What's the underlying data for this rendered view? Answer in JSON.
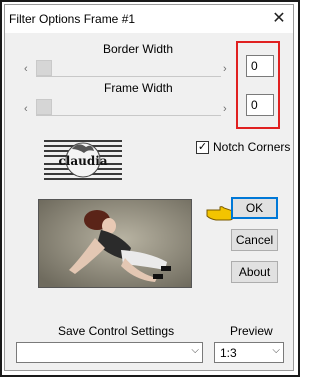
{
  "window": {
    "title": "Filter Options Frame #1",
    "close_glyph": "✕"
  },
  "border_width": {
    "label": "Border Width",
    "value": "0",
    "slider_level": 0
  },
  "frame_width": {
    "label": "Frame Width",
    "value": "0",
    "slider_level": 0
  },
  "slider_arrows": {
    "left": "‹",
    "right": "›"
  },
  "logo": {
    "text": "claudia"
  },
  "notch_corners": {
    "label": "Notch Corners",
    "checked": true,
    "check_glyph": "✓"
  },
  "buttons": {
    "ok": "OK",
    "cancel": "Cancel",
    "about": "About"
  },
  "save_settings": {
    "label": "Save Control Settings",
    "value": ""
  },
  "preview": {
    "label": "Preview",
    "value": "1:3"
  },
  "colors": {
    "highlight_box": "#e02020",
    "default_button_border": "#0078d7",
    "pointer_hand": "#f3c400"
  }
}
